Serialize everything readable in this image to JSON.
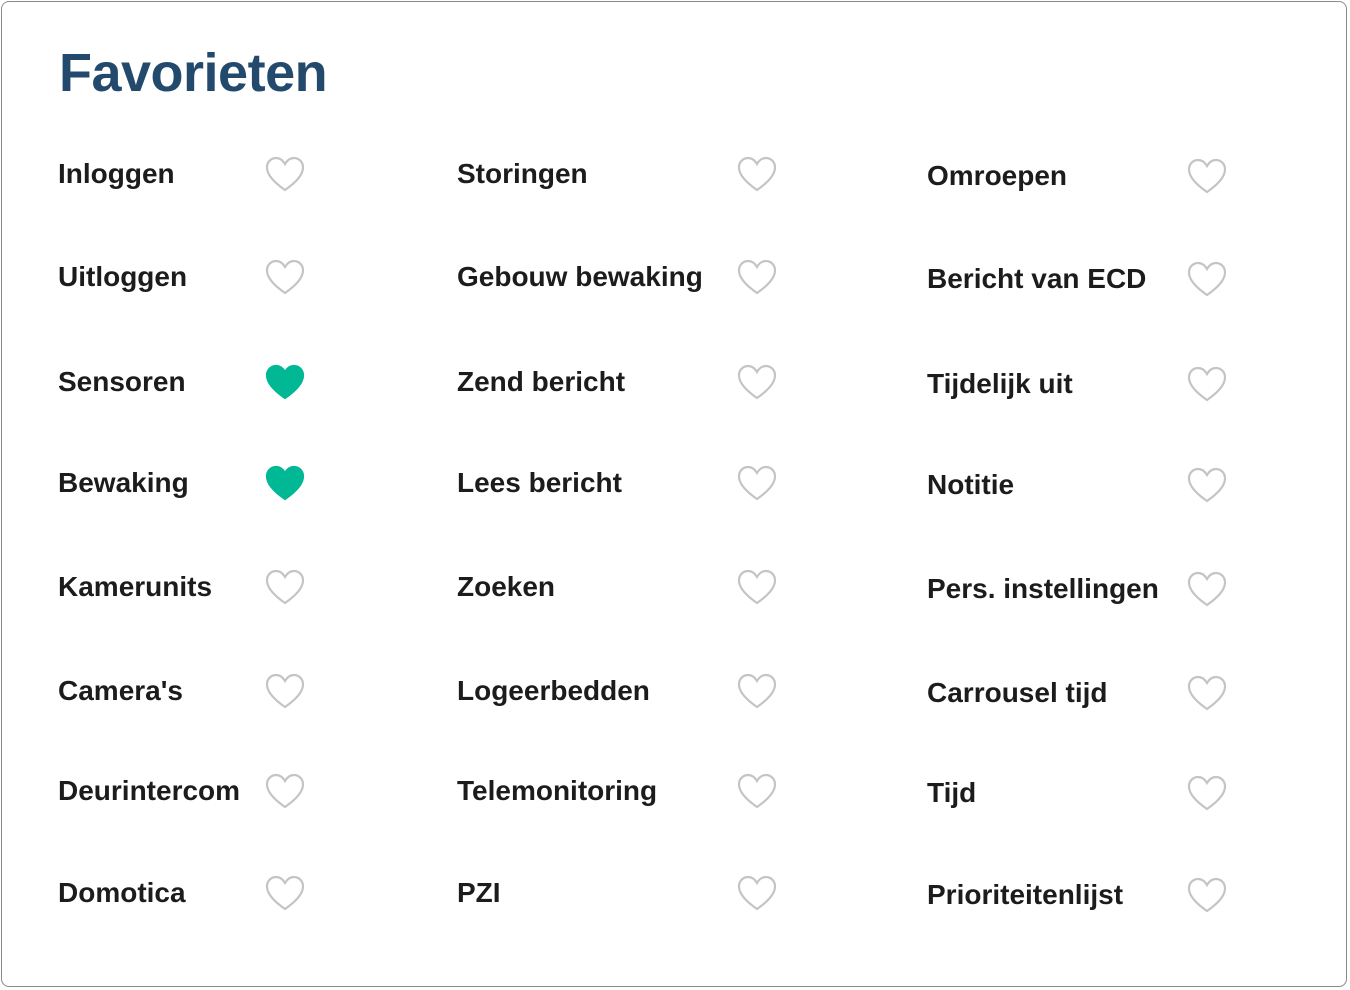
{
  "title": "Favorieten",
  "accent_color": "#00b894",
  "title_color": "#234a6c",
  "columns": [
    {
      "items": [
        {
          "label": "Inloggen",
          "favorite": false
        },
        {
          "label": "Uitloggen",
          "favorite": false
        },
        {
          "label": "Sensoren",
          "favorite": true
        },
        {
          "label": "Bewaking",
          "favorite": true
        },
        {
          "label": "Kamerunits",
          "favorite": false
        },
        {
          "label": "Camera's",
          "favorite": false
        },
        {
          "label": "Deurintercom",
          "favorite": false
        },
        {
          "label": "Domotica",
          "favorite": false
        }
      ]
    },
    {
      "items": [
        {
          "label": "Storingen",
          "favorite": false
        },
        {
          "label": "Gebouw bewaking",
          "favorite": false
        },
        {
          "label": "Zend bericht",
          "favorite": false
        },
        {
          "label": "Lees bericht",
          "favorite": false
        },
        {
          "label": "Zoeken",
          "favorite": false
        },
        {
          "label": "Logeerbedden",
          "favorite": false
        },
        {
          "label": "Telemonitoring",
          "favorite": false
        },
        {
          "label": "PZI",
          "favorite": false
        }
      ]
    },
    {
      "items": [
        {
          "label": "Omroepen",
          "favorite": false
        },
        {
          "label": "Bericht van ECD",
          "favorite": false
        },
        {
          "label": "Tijdelijk uit",
          "favorite": false
        },
        {
          "label": "Notitie",
          "favorite": false
        },
        {
          "label": "Pers. instellingen",
          "favorite": false
        },
        {
          "label": "Carrousel tijd",
          "favorite": false
        },
        {
          "label": "Tijd",
          "favorite": false
        },
        {
          "label": "Prioriteitenlijst",
          "favorite": false
        }
      ]
    }
  ]
}
